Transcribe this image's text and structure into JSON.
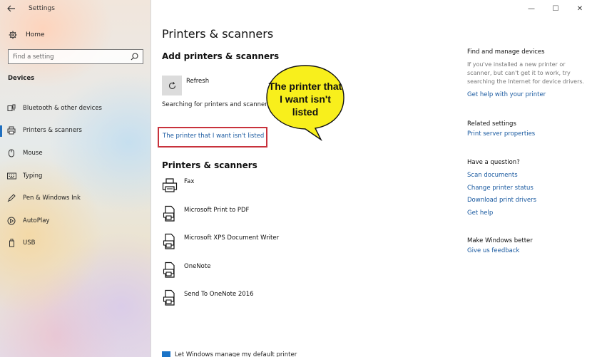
{
  "window": {
    "title": "Settings",
    "controls": {
      "minimize": "—",
      "maximize": "☐",
      "close": "✕"
    }
  },
  "sidebar": {
    "home_label": "Home",
    "search_placeholder": "Find a setting",
    "section_title": "Devices",
    "items": [
      {
        "label": "Bluetooth & other devices",
        "icon": "bluetooth-icon",
        "active": false
      },
      {
        "label": "Printers & scanners",
        "icon": "printer-icon",
        "active": true
      },
      {
        "label": "Mouse",
        "icon": "mouse-icon",
        "active": false
      },
      {
        "label": "Typing",
        "icon": "keyboard-icon",
        "active": false
      },
      {
        "label": "Pen & Windows Ink",
        "icon": "pen-icon",
        "active": false
      },
      {
        "label": "AutoPlay",
        "icon": "autoplay-icon",
        "active": false
      },
      {
        "label": "USB",
        "icon": "usb-icon",
        "active": false
      }
    ]
  },
  "main": {
    "page_title": "Printers & scanners",
    "add_title": "Add printers & scanners",
    "refresh_label": "Refresh",
    "searching_text": "Searching for printers and scanners",
    "not_listed_link": "The printer that I want isn't listed",
    "callout": "The printer that I want isn't listed",
    "printers_title": "Printers & scanners",
    "printers": [
      {
        "name": "Fax",
        "icon": "fax-icon"
      },
      {
        "name": "Microsoft Print to PDF",
        "icon": "printer-icon"
      },
      {
        "name": "Microsoft XPS Document Writer",
        "icon": "printer-icon"
      },
      {
        "name": "OneNote",
        "icon": "printer-icon"
      },
      {
        "name": "Send To OneNote 2016",
        "icon": "printer-icon"
      }
    ],
    "partial_checkbox_text": "Let Windows manage my default printer"
  },
  "right": {
    "find_manage_title": "Find and manage devices",
    "find_manage_text": "If you've installed a new printer or scanner, but can't get it to work, try searching the Internet for device drivers.",
    "find_manage_link": "Get help with your printer",
    "related_title": "Related settings",
    "related_link": "Print server properties",
    "question_title": "Have a question?",
    "question_links": [
      "Scan documents",
      "Change printer status",
      "Download print drivers",
      "Get help"
    ],
    "better_title": "Make Windows better",
    "better_link": "Give us feedback"
  },
  "colors": {
    "accent": "#1f6fbf",
    "link": "#1a5aa0",
    "highlight_box": "#c8323c",
    "callout_fill": "#f8ef1c"
  }
}
